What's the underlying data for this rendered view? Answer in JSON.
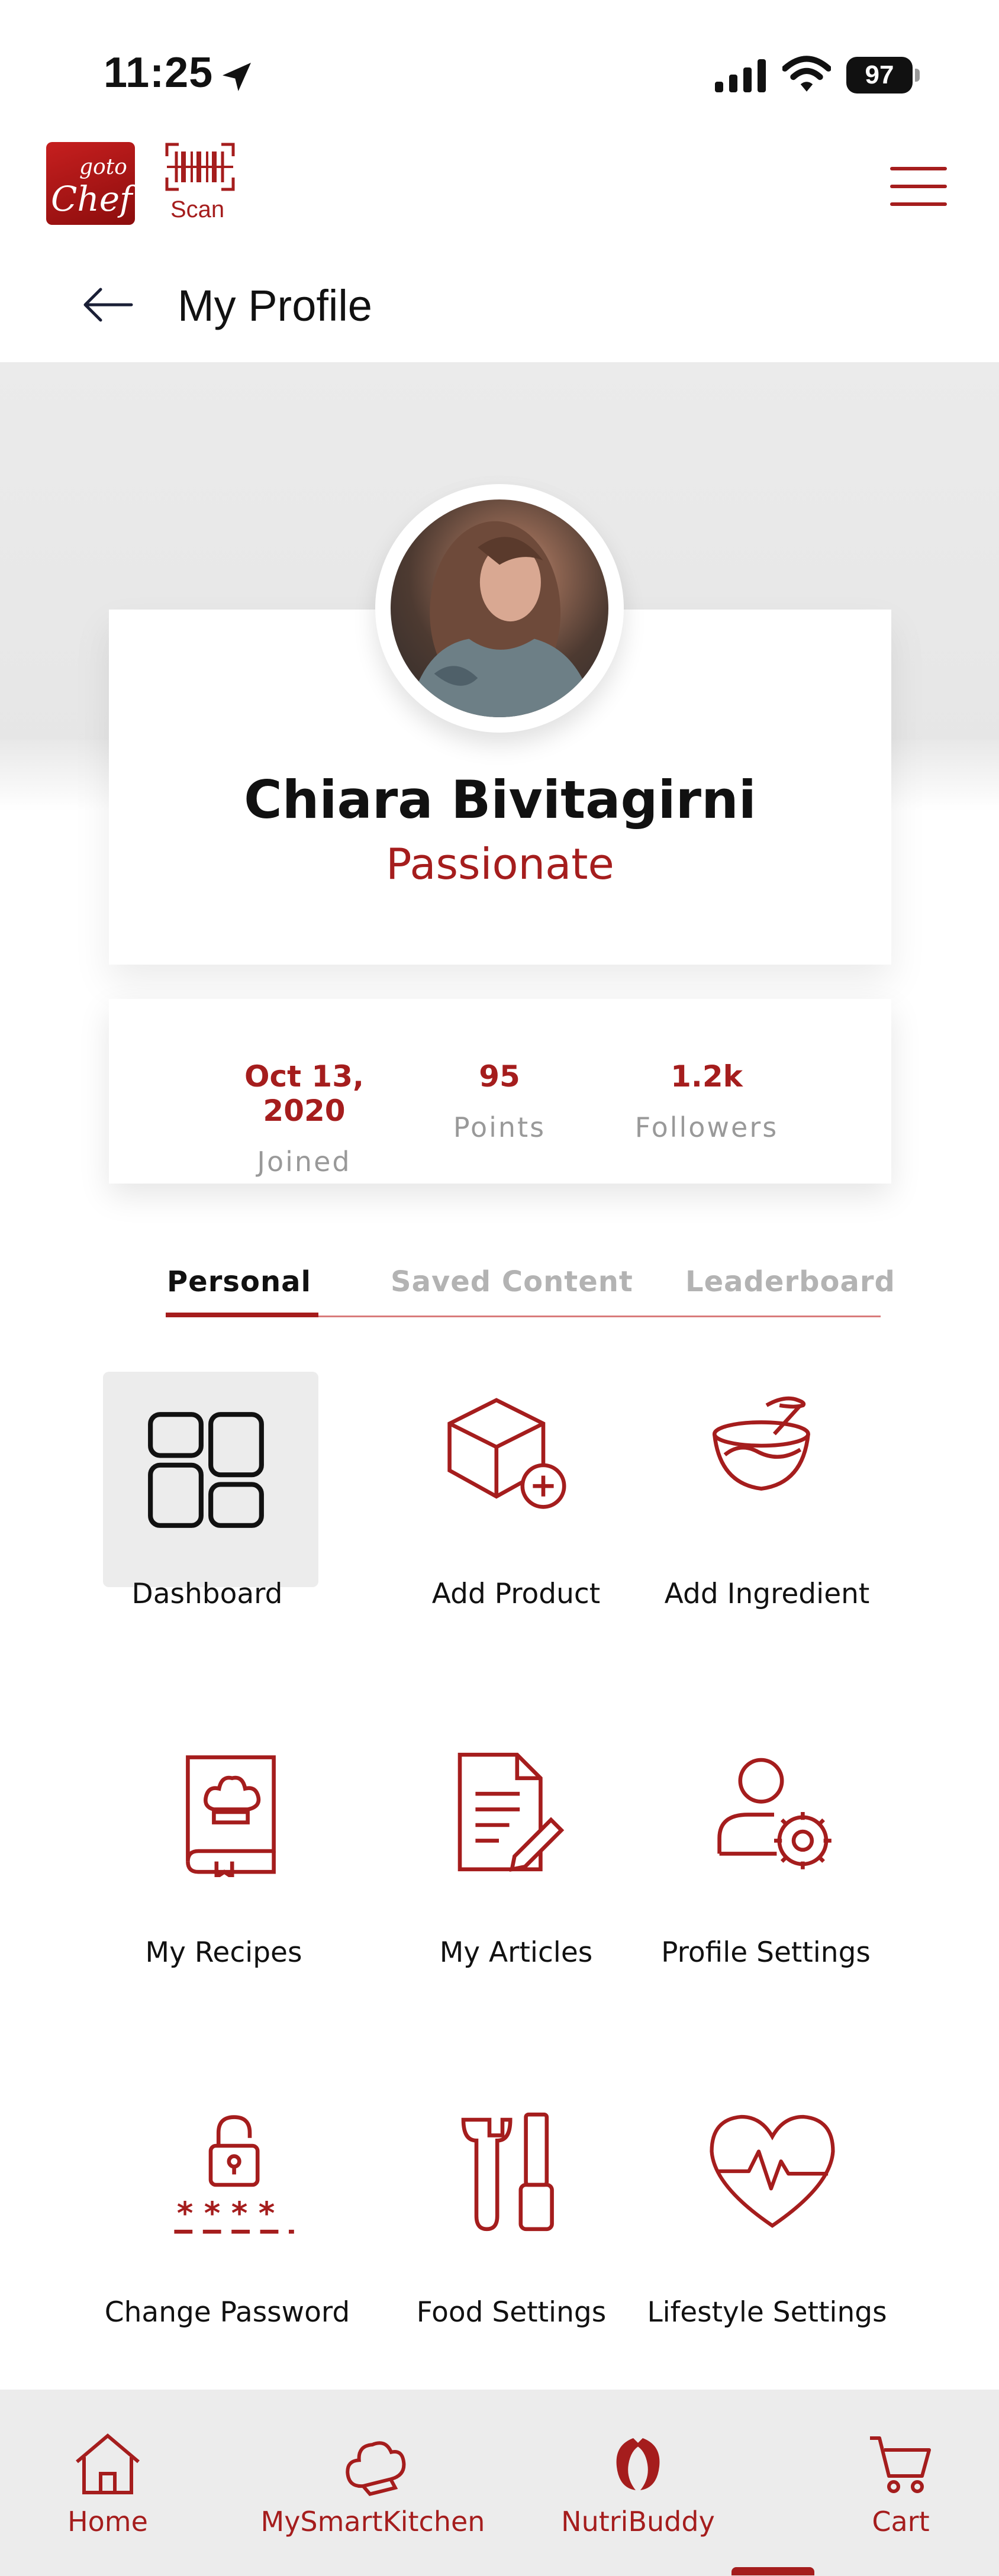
{
  "status_bar": {
    "time": "11:25",
    "battery": "97"
  },
  "header": {
    "logo_top": "goto",
    "logo_main": "Chef",
    "scan_label": "Scan"
  },
  "title_bar": {
    "title": "My Profile"
  },
  "profile": {
    "name": "Chiara Bivitagirni",
    "title": "Passionate"
  },
  "stats": [
    {
      "value": "Oct 13, 2020",
      "label": "Joined"
    },
    {
      "value": "95",
      "label": "Points"
    },
    {
      "value": "1.2k",
      "label": "Followers"
    }
  ],
  "tabs": [
    {
      "label": "Personal",
      "active": true
    },
    {
      "label": "Saved Content",
      "active": false
    },
    {
      "label": "Leaderboard",
      "active": false
    }
  ],
  "grid": [
    {
      "label": "Dashboard",
      "icon": "dashboard-icon"
    },
    {
      "label": "Add Product",
      "icon": "add-product-icon"
    },
    {
      "label": "Add Ingredient",
      "icon": "add-ingredient-icon"
    },
    {
      "label": "My Recipes",
      "icon": "recipe-book-icon"
    },
    {
      "label": "My Articles",
      "icon": "article-icon"
    },
    {
      "label": "Profile Settings",
      "icon": "profile-settings-icon"
    },
    {
      "label": "Change Password",
      "icon": "lock-icon"
    },
    {
      "label": "Food Settings",
      "icon": "tools-icon"
    },
    {
      "label": "Lifestyle Settings",
      "icon": "heart-pulse-icon"
    }
  ],
  "bottom_nav": [
    {
      "label": "Home",
      "icon": "home-icon"
    },
    {
      "label": "MySmartKitchen",
      "icon": "chef-hat-icon"
    },
    {
      "label": "NutriBuddy",
      "icon": "nutribuddy-icon"
    },
    {
      "label": "Cart",
      "icon": "cart-icon"
    }
  ],
  "colors": {
    "accent": "#a51d1d",
    "tile_bg": "#ececec",
    "muted": "#999999"
  }
}
